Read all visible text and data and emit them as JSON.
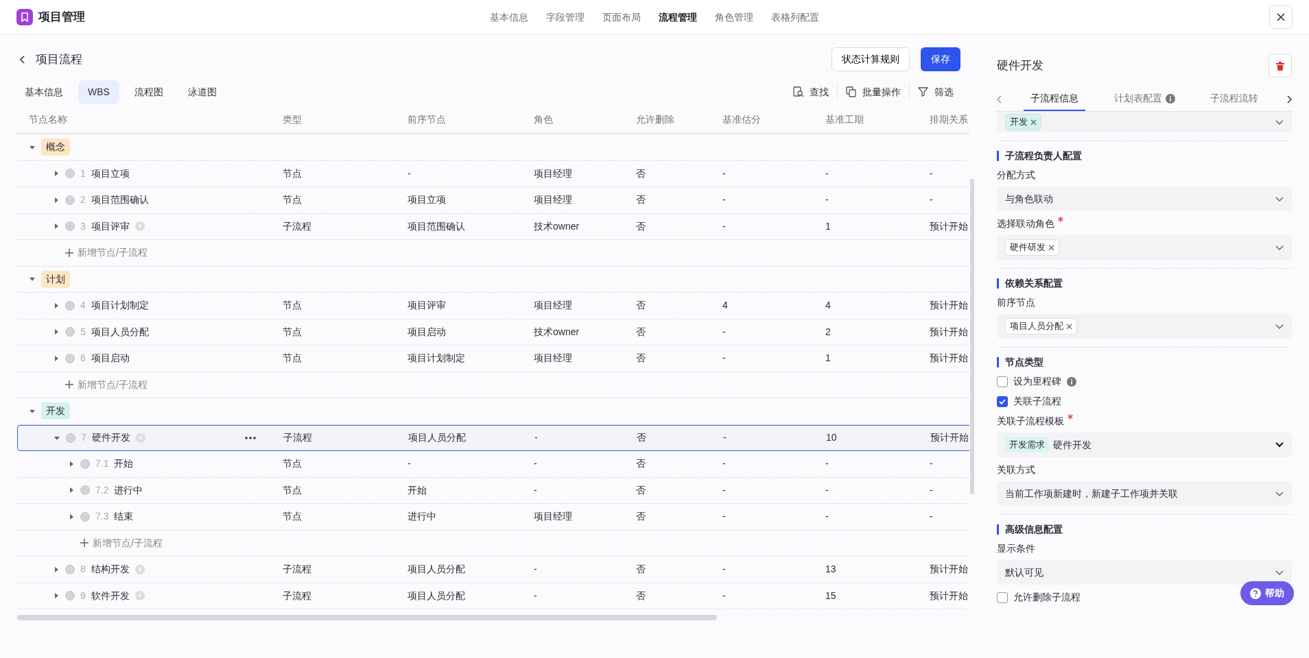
{
  "app": {
    "title": "项目管理"
  },
  "top_nav": [
    {
      "label": "基本信息",
      "selected": false
    },
    {
      "label": "字段管理",
      "selected": false
    },
    {
      "label": "页面布局",
      "selected": false
    },
    {
      "label": "流程管理",
      "selected": true
    },
    {
      "label": "角色管理",
      "selected": false
    },
    {
      "label": "表格列配置",
      "selected": false
    }
  ],
  "page": {
    "title": "项目流程",
    "buttons": [
      {
        "label": "状态计算规则",
        "kind": "secondary"
      },
      {
        "label": "保存",
        "kind": "primary"
      }
    ]
  },
  "view_tabs": [
    {
      "label": "基本信息",
      "selected": false
    },
    {
      "label": "WBS",
      "selected": true
    },
    {
      "label": "流程图",
      "selected": false
    },
    {
      "label": "泳道图",
      "selected": false
    }
  ],
  "toolbar": [
    {
      "label": "查找",
      "kind": "find"
    },
    {
      "label": "批量操作",
      "kind": "batch"
    },
    {
      "label": "筛选",
      "kind": "filter"
    }
  ],
  "table": {
    "columns": [
      "节点名称",
      "类型",
      "前序节点",
      "角色",
      "允许删除",
      "基准估分",
      "基准工期",
      "排期关系"
    ],
    "groups": [
      {
        "label": "概念",
        "color": "#fde6c2",
        "expanded": true,
        "add_label": "新增节点/子流程",
        "rows": [
          {
            "number": "1",
            "name": "项目立项",
            "kind": "node",
            "expanded": false,
            "selected": false,
            "cells": [
              "节点",
              "-",
              "项目经理",
              "否",
              "-",
              "-",
              "-"
            ]
          },
          {
            "number": "2",
            "name": "项目范围确认",
            "kind": "node",
            "expanded": false,
            "selected": false,
            "cells": [
              "节点",
              "项目立项",
              "项目经理",
              "否",
              "-",
              "-",
              "-"
            ]
          },
          {
            "number": "3",
            "name": "项目评审",
            "kind": "subflow",
            "expanded": false,
            "selected": false,
            "cells": [
              "子流程",
              "项目范围确认",
              "技术owner",
              "否",
              "-",
              "1",
              "预计开始"
            ]
          }
        ]
      },
      {
        "label": "计划",
        "color": "#fde6c2",
        "expanded": true,
        "add_label": "新增节点/子流程",
        "rows": [
          {
            "number": "4",
            "name": "项目计划制定",
            "kind": "node",
            "expanded": false,
            "selected": false,
            "cells": [
              "节点",
              "项目评审",
              "项目经理",
              "否",
              "4",
              "4",
              "预计开始"
            ]
          },
          {
            "number": "5",
            "name": "项目人员分配",
            "kind": "node",
            "expanded": false,
            "selected": false,
            "cells": [
              "节点",
              "项目启动",
              "技术owner",
              "否",
              "-",
              "2",
              "预计开始"
            ]
          },
          {
            "number": "6",
            "name": "项目启动",
            "kind": "node",
            "expanded": false,
            "selected": false,
            "cells": [
              "节点",
              "项目计划制定",
              "项目经理",
              "否",
              "-",
              "1",
              "预计开始"
            ]
          }
        ]
      },
      {
        "label": "开发",
        "color": "#d3f3ec",
        "expanded": true,
        "rows": [
          {
            "number": "7",
            "name": "硬件开发",
            "kind": "subflow",
            "expanded": true,
            "selected": true,
            "cells": [
              "子流程",
              "项目人员分配",
              "-",
              "否",
              "-",
              "10",
              "预计开始"
            ],
            "add_label": "新增节点/子流程",
            "children": [
              {
                "number": "7.1",
                "name": "开始",
                "kind": "node",
                "expanded": false,
                "selected": false,
                "cells": [
                  "节点",
                  "-",
                  "-",
                  "否",
                  "-",
                  "-",
                  "-"
                ]
              },
              {
                "number": "7.2",
                "name": "进行中",
                "kind": "node",
                "expanded": false,
                "selected": false,
                "cells": [
                  "节点",
                  "开始",
                  "-",
                  "否",
                  "-",
                  "-",
                  "-"
                ]
              },
              {
                "number": "7.3",
                "name": "结束",
                "kind": "node",
                "expanded": false,
                "selected": false,
                "cells": [
                  "节点",
                  "进行中",
                  "项目经理",
                  "否",
                  "-",
                  "-",
                  "-"
                ]
              }
            ]
          },
          {
            "number": "8",
            "name": "结构开发",
            "kind": "subflow",
            "expanded": false,
            "selected": false,
            "cells": [
              "子流程",
              "项目人员分配",
              "-",
              "否",
              "-",
              "13",
              "预计开始"
            ]
          },
          {
            "number": "9",
            "name": "软件开发",
            "kind": "subflow",
            "expanded": false,
            "selected": false,
            "cells": [
              "子流程",
              "项目人员分配",
              "-",
              "否",
              "-",
              "15",
              "预计开始"
            ]
          }
        ]
      }
    ]
  },
  "detail": {
    "title": "硬件开发",
    "tabs": [
      {
        "label": "子流程信息",
        "selected": true
      },
      {
        "label": "计划表配置",
        "selected": false,
        "info": true
      },
      {
        "label": "子流程流转",
        "selected": false
      }
    ],
    "top_field": {
      "tags": [
        {
          "label": "开发",
          "color": "#d3f3ec"
        }
      ]
    },
    "sections": [
      {
        "title": "子流程负责人配置",
        "fields": [
          {
            "kind": "select",
            "label": "分配方式",
            "value": "与角色联动"
          },
          {
            "kind": "tags",
            "label": "选择联动角色",
            "required": true,
            "tags": [
              {
                "label": "硬件研发",
                "color": "#ffffff"
              }
            ]
          }
        ]
      },
      {
        "title": "依赖关系配置",
        "fields": [
          {
            "kind": "tags",
            "label": "前序节点",
            "tags": [
              {
                "label": "项目人员分配",
                "color": "#ffffff"
              }
            ]
          }
        ]
      },
      {
        "title": "节点类型",
        "fields": [
          {
            "kind": "checkbox",
            "label": "设为里程碑",
            "checked": false,
            "info": true
          },
          {
            "kind": "checkbox",
            "label": "关联子流程",
            "checked": true
          },
          {
            "kind": "template",
            "label": "关联子流程模板",
            "required": true,
            "badge": "开发需求",
            "value": "硬件开发"
          },
          {
            "kind": "select",
            "label": "关联方式",
            "value": "当前工作项新建时，新建子工作项并关联"
          }
        ]
      },
      {
        "title": "高级信息配置",
        "fields": [
          {
            "kind": "select",
            "label": "显示条件",
            "value": "默认可见"
          },
          {
            "kind": "checkbox",
            "label": "允许删除子流程",
            "checked": false
          }
        ]
      }
    ],
    "help": {
      "label": "帮助"
    }
  }
}
